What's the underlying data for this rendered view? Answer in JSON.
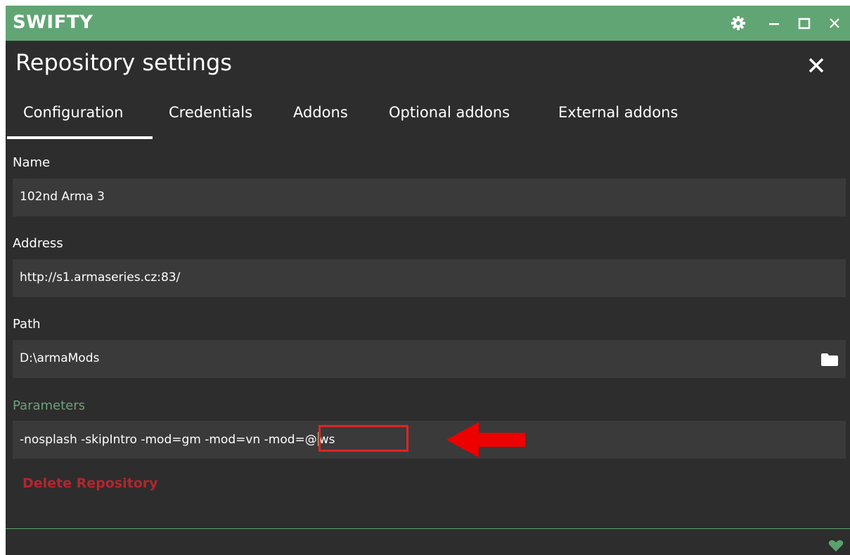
{
  "app": {
    "title": "SWIFTY"
  },
  "window_controls": {
    "settings_icon": "gear-icon",
    "minimize_icon": "minimize-icon",
    "maximize_icon": "maximize-icon",
    "close_icon": "close-icon"
  },
  "header": {
    "title": "Repository settings",
    "close_icon": "close-icon"
  },
  "tabs": [
    {
      "label": "Configuration",
      "active": true
    },
    {
      "label": "Credentials",
      "active": false
    },
    {
      "label": "Addons",
      "active": false
    },
    {
      "label": "Optional addons",
      "active": false
    },
    {
      "label": "External addons",
      "active": false
    }
  ],
  "form": {
    "name": {
      "label": "Name",
      "value": "102nd Arma 3"
    },
    "address": {
      "label": "Address",
      "value": "http://s1.armaseries.cz:83/"
    },
    "path": {
      "label": "Path",
      "value": "D:\\armaMods",
      "button_icon": "folder-icon"
    },
    "parameters": {
      "label": "Parameters",
      "value_before_highlight": "-nosplash -skipIntro -mod=gm -mod=vn ",
      "highlight_before_caret": "-mod=@",
      "highlight_after_caret": "ws",
      "annotation_icon": "red-arrow-icon"
    }
  },
  "actions": {
    "delete_label": "Delete Repository"
  },
  "status_bar": {
    "icon": "heart-icon"
  },
  "colors": {
    "titlebar": "#62a574",
    "background": "#2d2d2d",
    "field": "#3a3a3a",
    "accent_label": "#6ea07a",
    "danger": "#b3262e",
    "annotation": "#e02424"
  }
}
